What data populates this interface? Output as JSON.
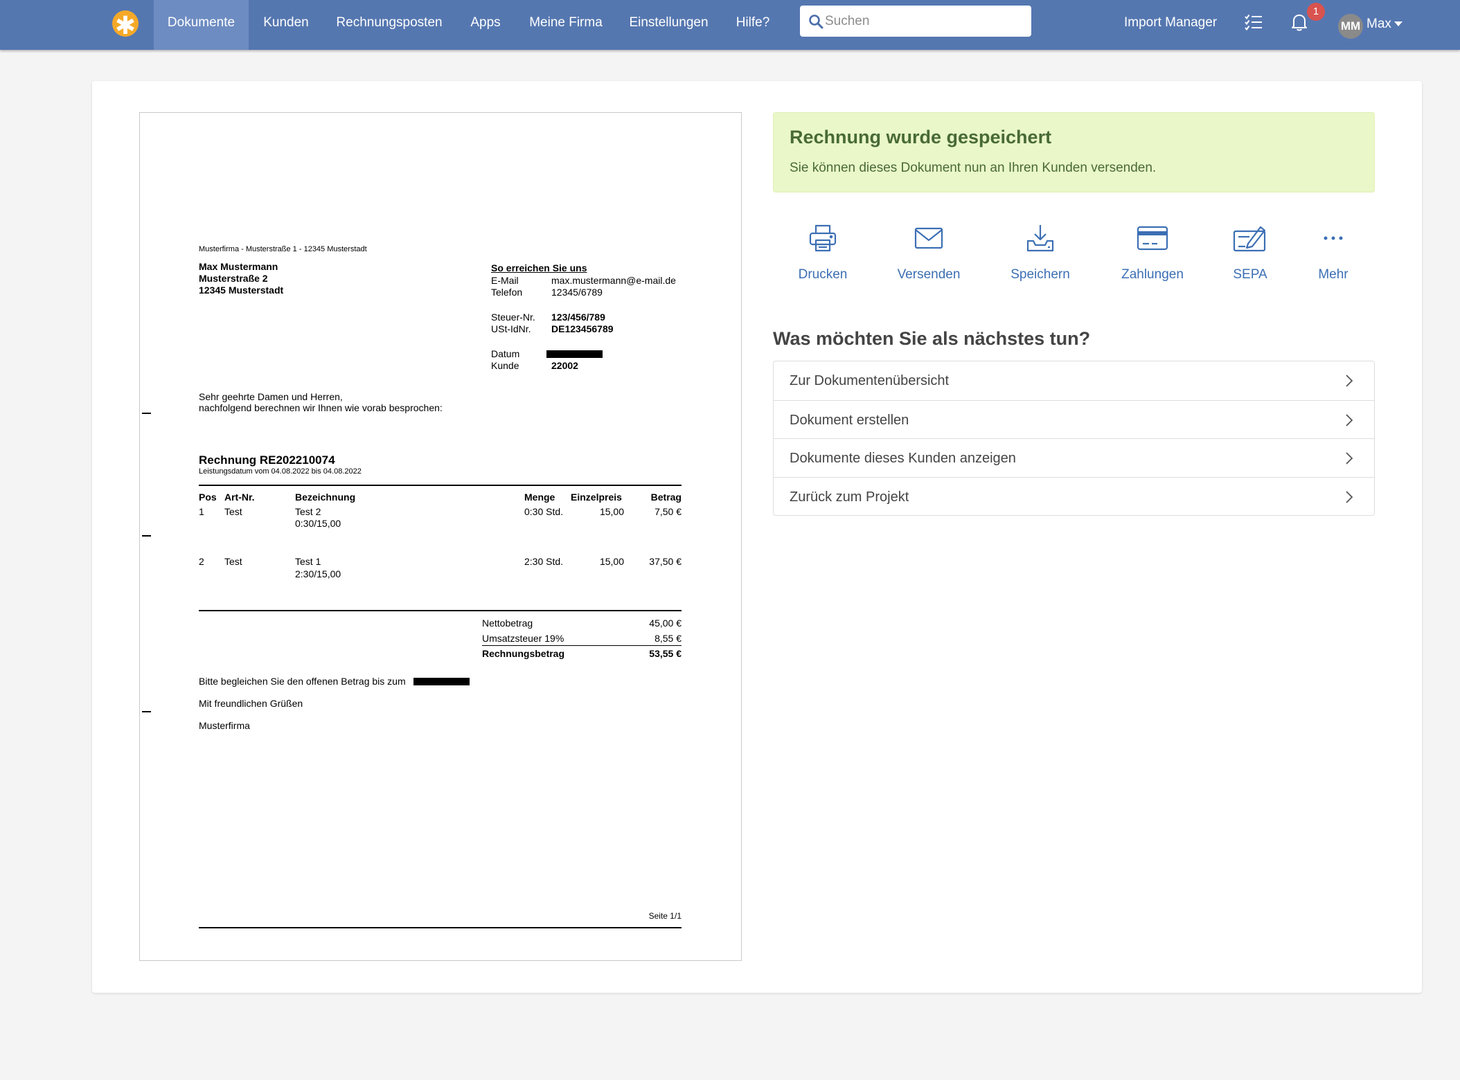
{
  "nav": {
    "items": [
      {
        "label": "Dokumente",
        "active": true
      },
      {
        "label": "Kunden"
      },
      {
        "label": "Rechnungsposten"
      },
      {
        "label": "Apps"
      },
      {
        "label": "Meine Firma"
      },
      {
        "label": "Einstellungen"
      },
      {
        "label": "Hilfe?"
      }
    ],
    "search_placeholder": "Suchen",
    "import_manager": "Import Manager",
    "notification_count": "1",
    "avatar_initials": "MM",
    "username": "Max"
  },
  "invoice": {
    "sender_line": "Musterfirma - Musterstraße 1 - 12345 Musterstadt",
    "recipient": {
      "name": "Max Mustermann",
      "street": "Musterstraße 2",
      "city": "12345 Musterstadt"
    },
    "contact_heading": "So erreichen Sie uns",
    "email_label": "E-Mail",
    "email": "max.mustermann@e-mail.de",
    "phone_label": "Telefon",
    "phone": "12345/6789",
    "tax_label": "Steuer-Nr.",
    "tax": "123/456/789",
    "vat_label": "USt-IdNr.",
    "vat": "DE123456789",
    "date_label": "Datum",
    "customer_label": "Kunde",
    "customer": "22002",
    "greeting1": "Sehr geehrte Damen und Herren,",
    "greeting2": "nachfolgend berechnen wir Ihnen wie vorab besprochen:",
    "title": "Rechnung RE202210074",
    "service_date": "Leistungsdatum vom 04.08.2022 bis 04.08.2022",
    "columns": {
      "pos": "Pos",
      "art": "Art-Nr.",
      "desc": "Bezeichnung",
      "qty": "Menge",
      "unit": "Einzelpreis",
      "amount": "Betrag"
    },
    "rows": [
      {
        "pos": "1",
        "art": "Test",
        "desc": "Test 2",
        "desc2": "0:30/15,00",
        "qty": "0:30 Std.",
        "unit": "15,00",
        "amount": "7,50 €"
      },
      {
        "pos": "2",
        "art": "Test",
        "desc": "Test 1",
        "desc2": "2:30/15,00",
        "qty": "2:30 Std.",
        "unit": "15,00",
        "amount": "37,50 €"
      }
    ],
    "net_label": "Nettobetrag",
    "net": "45,00 €",
    "vat_tax_label": "Umsatzsteuer 19%",
    "vat_tax": "8,55 €",
    "total_label": "Rechnungsbetrag",
    "total": "53,55 €",
    "pay_text": "Bitte begleichen Sie den offenen Betrag bis zum",
    "regards": "Mit freundlichen Grüßen",
    "company": "Musterfirma",
    "page": "Seite 1/1"
  },
  "alert": {
    "title": "Rechnung wurde gespeichert",
    "text": "Sie können dieses Dokument nun an Ihren Kunden versenden."
  },
  "actions": [
    {
      "label": "Drucken",
      "icon": "printer-icon"
    },
    {
      "label": "Versenden",
      "icon": "envelope-icon"
    },
    {
      "label": "Speichern",
      "icon": "download-icon"
    },
    {
      "label": "Zahlungen",
      "icon": "credit-card-icon"
    },
    {
      "label": "SEPA",
      "icon": "sepa-icon"
    },
    {
      "label": "Mehr",
      "icon": "more-icon"
    }
  ],
  "next": {
    "title": "Was möchten Sie als nächstes tun?",
    "items": [
      {
        "label": "Zur Dokumentenübersicht"
      },
      {
        "label": "Dokument erstellen"
      },
      {
        "label": "Dokumente dieses Kunden anzeigen"
      },
      {
        "label": "Zurück zum Projekt"
      }
    ]
  },
  "colors": {
    "nav": "#5577b0",
    "accent": "#3c6fb4",
    "success_bg": "#eaf7c8",
    "success_text": "#486a37",
    "logo": "#f6a928"
  }
}
